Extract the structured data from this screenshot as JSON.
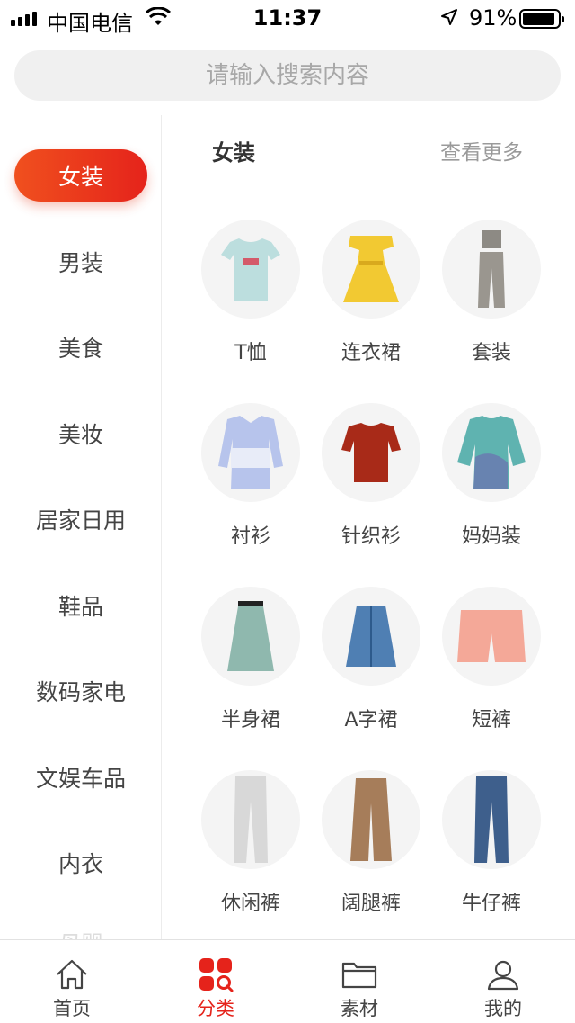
{
  "status": {
    "carrier": "中国电信",
    "time": "11:37",
    "battery": "91%",
    "battery_level": 0.91,
    "icons": [
      "signal-icon",
      "wifi-icon",
      "location-icon",
      "battery-icon"
    ]
  },
  "search": {
    "placeholder": "请输入搜索内容"
  },
  "sidebar": {
    "items": [
      {
        "label": "女装"
      },
      {
        "label": "男装"
      },
      {
        "label": "美食"
      },
      {
        "label": "美妆"
      },
      {
        "label": "居家日用"
      },
      {
        "label": "鞋品"
      },
      {
        "label": "数码家电"
      },
      {
        "label": "文娱车品"
      },
      {
        "label": "内衣"
      },
      {
        "label": "母婴"
      }
    ],
    "active": "女装"
  },
  "section": {
    "title": "女装",
    "more": "查看更多"
  },
  "categories": [
    {
      "label": "T恤",
      "icon": "tshirt-icon"
    },
    {
      "label": "连衣裙",
      "icon": "dress-icon"
    },
    {
      "label": "套装",
      "icon": "set-outfit-icon"
    },
    {
      "label": "衬衫",
      "icon": "shirt-icon"
    },
    {
      "label": "针织衫",
      "icon": "knit-top-icon"
    },
    {
      "label": "妈妈装",
      "icon": "tunic-icon"
    },
    {
      "label": "半身裙",
      "icon": "skirt-icon"
    },
    {
      "label": "A字裙",
      "icon": "a-line-skirt-icon"
    },
    {
      "label": "短裤",
      "icon": "shorts-icon"
    },
    {
      "label": "休闲裤",
      "icon": "casual-pants-icon"
    },
    {
      "label": "阔腿裤",
      "icon": "wide-leg-pants-icon"
    },
    {
      "label": "牛仔裤",
      "icon": "jeans-icon"
    }
  ],
  "tabbar": {
    "items": [
      {
        "label": "首页",
        "icon": "home-icon"
      },
      {
        "label": "分类",
        "icon": "category-icon"
      },
      {
        "label": "素材",
        "icon": "folder-icon"
      },
      {
        "label": "我的",
        "icon": "user-icon"
      }
    ],
    "active": "分类"
  },
  "colors": {
    "accent": "#e5231b",
    "accent_start": "#f0501e",
    "search_bg": "#f0f0f0"
  }
}
